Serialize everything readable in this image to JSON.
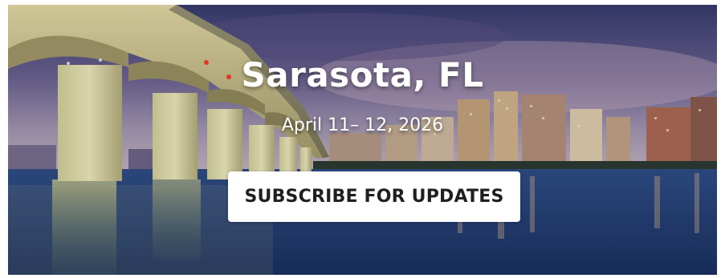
{
  "hero": {
    "city_title": "Sarasota, FL",
    "dates": "April 11– 12, 2026",
    "subscribe_label": "SUBSCRIBE FOR UPDATES"
  },
  "colors": {
    "sky_top": "#3b3f70",
    "sky_mid": "#8a7fa5",
    "water": "#1f3f77",
    "bridge_light": "#f3e7a6",
    "button_bg": "#ffffff",
    "button_text": "#1f1f1f"
  }
}
